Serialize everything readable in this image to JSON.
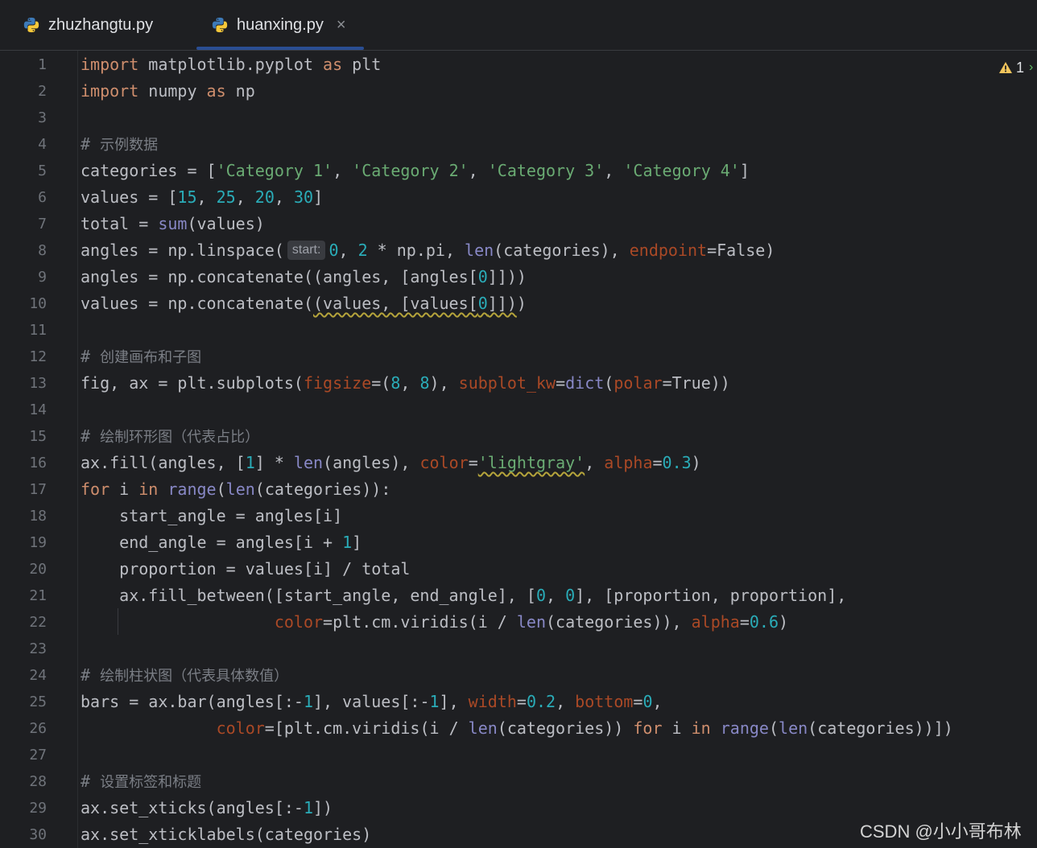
{
  "tabs": [
    {
      "label": "zhuzhangtu.py",
      "active": false
    },
    {
      "label": "huanxing.py",
      "active": true,
      "close": "×"
    }
  ],
  "inspection": {
    "warnings": "1"
  },
  "line_numbers": [
    "1",
    "2",
    "3",
    "4",
    "5",
    "6",
    "7",
    "8",
    "9",
    "10",
    "11",
    "12",
    "13",
    "14",
    "15",
    "16",
    "17",
    "18",
    "19",
    "20",
    "21",
    "22",
    "23",
    "24",
    "25",
    "26",
    "27",
    "28",
    "29",
    "30"
  ],
  "code": {
    "l1": [
      "import",
      " matplotlib.pyplot ",
      "as",
      " plt"
    ],
    "l2": [
      "import",
      " numpy ",
      "as",
      " np"
    ],
    "l4": [
      "# ",
      "示例数据"
    ],
    "l5": [
      "categories = [",
      "'Category 1'",
      ", ",
      "'Category 2'",
      ", ",
      "'Category 3'",
      ", ",
      "'Category 4'",
      "]"
    ],
    "l6": [
      "values = [",
      "15",
      ", ",
      "25",
      ", ",
      "20",
      ", ",
      "30",
      "]"
    ],
    "l7": [
      "total = ",
      "sum",
      "(values)"
    ],
    "l8": [
      "angles = np.linspace(",
      "start:",
      "0",
      ", ",
      "2",
      " * np.pi, ",
      "len",
      "(categories), ",
      "endpoint",
      "=False)"
    ],
    "l9": [
      "angles = np.concatenate((angles, [angles[",
      "0",
      "]]))"
    ],
    "l10": [
      "values = np.concatenate(",
      "(values, [values[",
      "0",
      "]])",
      ")"
    ],
    "l12": [
      "# ",
      "创建画布和子图"
    ],
    "l13": [
      "fig, ax = plt.subplots(",
      "figsize",
      "=(",
      "8",
      ", ",
      "8",
      "), ",
      "subplot_kw",
      "=",
      "dict",
      "(",
      "polar",
      "=True))"
    ],
    "l15": [
      "# ",
      "绘制环形图（代表占比）"
    ],
    "l16": [
      "ax.fill(angles, [",
      "1",
      "] * ",
      "len",
      "(angles), ",
      "color",
      "=",
      "'lightgray'",
      ", ",
      "alpha",
      "=",
      "0.3",
      ")"
    ],
    "l17": [
      "for",
      " i ",
      "in",
      " ",
      "range",
      "(",
      "len",
      "(categories)):"
    ],
    "l18": [
      "    start_angle = angles[i]"
    ],
    "l19": [
      "    end_angle = angles[i + ",
      "1",
      "]"
    ],
    "l20": [
      "    proportion = values[i] / total"
    ],
    "l21": [
      "    ax.fill_between([start_angle, end_angle], [",
      "0",
      ", ",
      "0",
      "], [proportion, proportion],"
    ],
    "l22": [
      "                    ",
      "color",
      "=plt.cm.viridis(i / ",
      "len",
      "(categories)), ",
      "alpha",
      "=",
      "0.6",
      ")"
    ],
    "l24": [
      "# ",
      "绘制柱状图（代表具体数值）"
    ],
    "l25": [
      "bars = ax.bar(angles[:-",
      "1",
      "], values[:-",
      "1",
      "], ",
      "width",
      "=",
      "0.2",
      ", ",
      "bottom",
      "=",
      "0",
      ","
    ],
    "l26": [
      "              ",
      "color",
      "=[plt.cm.viridis(i / ",
      "len",
      "(categories)) ",
      "for",
      " i ",
      "in",
      " ",
      "range",
      "(",
      "len",
      "(categories))])"
    ],
    "l28": [
      "# ",
      "设置标签和标题"
    ],
    "l29": [
      "ax.set_xticks(angles[:-",
      "1",
      "])"
    ],
    "l30": [
      "ax.set_xticklabels(categories)"
    ]
  },
  "watermark": "CSDN @小小哥布林",
  "colors": {
    "background": "#1e1f22",
    "keyword": "#cf8e6d",
    "number": "#2aacb8",
    "string": "#6aab73",
    "builtin": "#8888c6",
    "param": "#aa4926"
  }
}
